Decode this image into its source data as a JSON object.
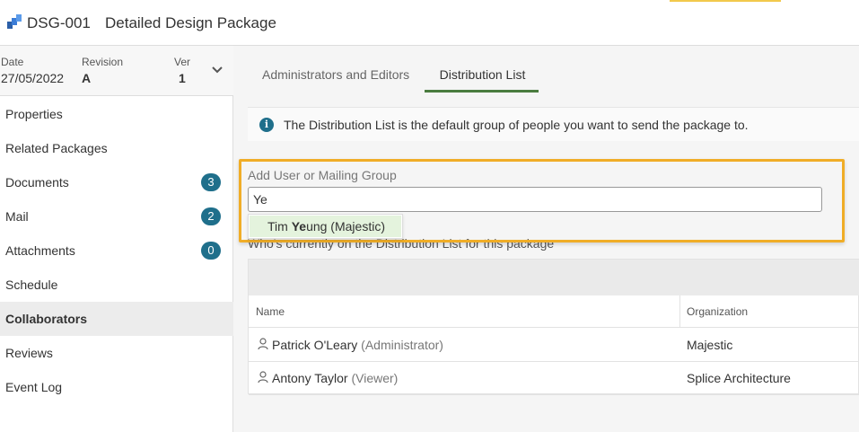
{
  "header": {
    "code": "DSG-001",
    "title": "Detailed Design Package"
  },
  "meta": {
    "date_label": "Date",
    "date_value": "27/05/2022",
    "revision_label": "Revision",
    "revision_value": "A",
    "ver_label": "Ver",
    "ver_value": "1"
  },
  "nav": [
    {
      "label": "Properties"
    },
    {
      "label": "Related Packages"
    },
    {
      "label": "Documents",
      "badge": "3"
    },
    {
      "label": "Mail",
      "badge": "2"
    },
    {
      "label": "Attachments",
      "badge": "0"
    },
    {
      "label": "Schedule"
    },
    {
      "label": "Collaborators",
      "active": true
    },
    {
      "label": "Reviews"
    },
    {
      "label": "Event Log"
    }
  ],
  "tabs": {
    "admins": "Administrators and Editors",
    "distribution": "Distribution List"
  },
  "info": {
    "text": "The Distribution List is the default group of people you want to send the package to."
  },
  "add_user": {
    "label": "Add User or Mailing Group",
    "value": "Ye",
    "suggestion": {
      "prefix": "Tim ",
      "match": "Ye",
      "suffix": "ung (Majestic)"
    }
  },
  "current_label": "Who's currently on the Distribution List for this package",
  "table": {
    "columns": {
      "name": "Name",
      "organization": "Organization"
    },
    "rows": [
      {
        "name": "Patrick O'Leary",
        "role": "(Administrator)",
        "organization": "Majestic"
      },
      {
        "name": "Antony Taylor",
        "role": "(Viewer)",
        "organization": "Splice Architecture"
      }
    ]
  },
  "colors": {
    "accent": "#1f6f8b",
    "highlight": "#f0ad27",
    "tab_underline": "#4a7c3f",
    "suggestion_bg": "#e4f3dd"
  }
}
